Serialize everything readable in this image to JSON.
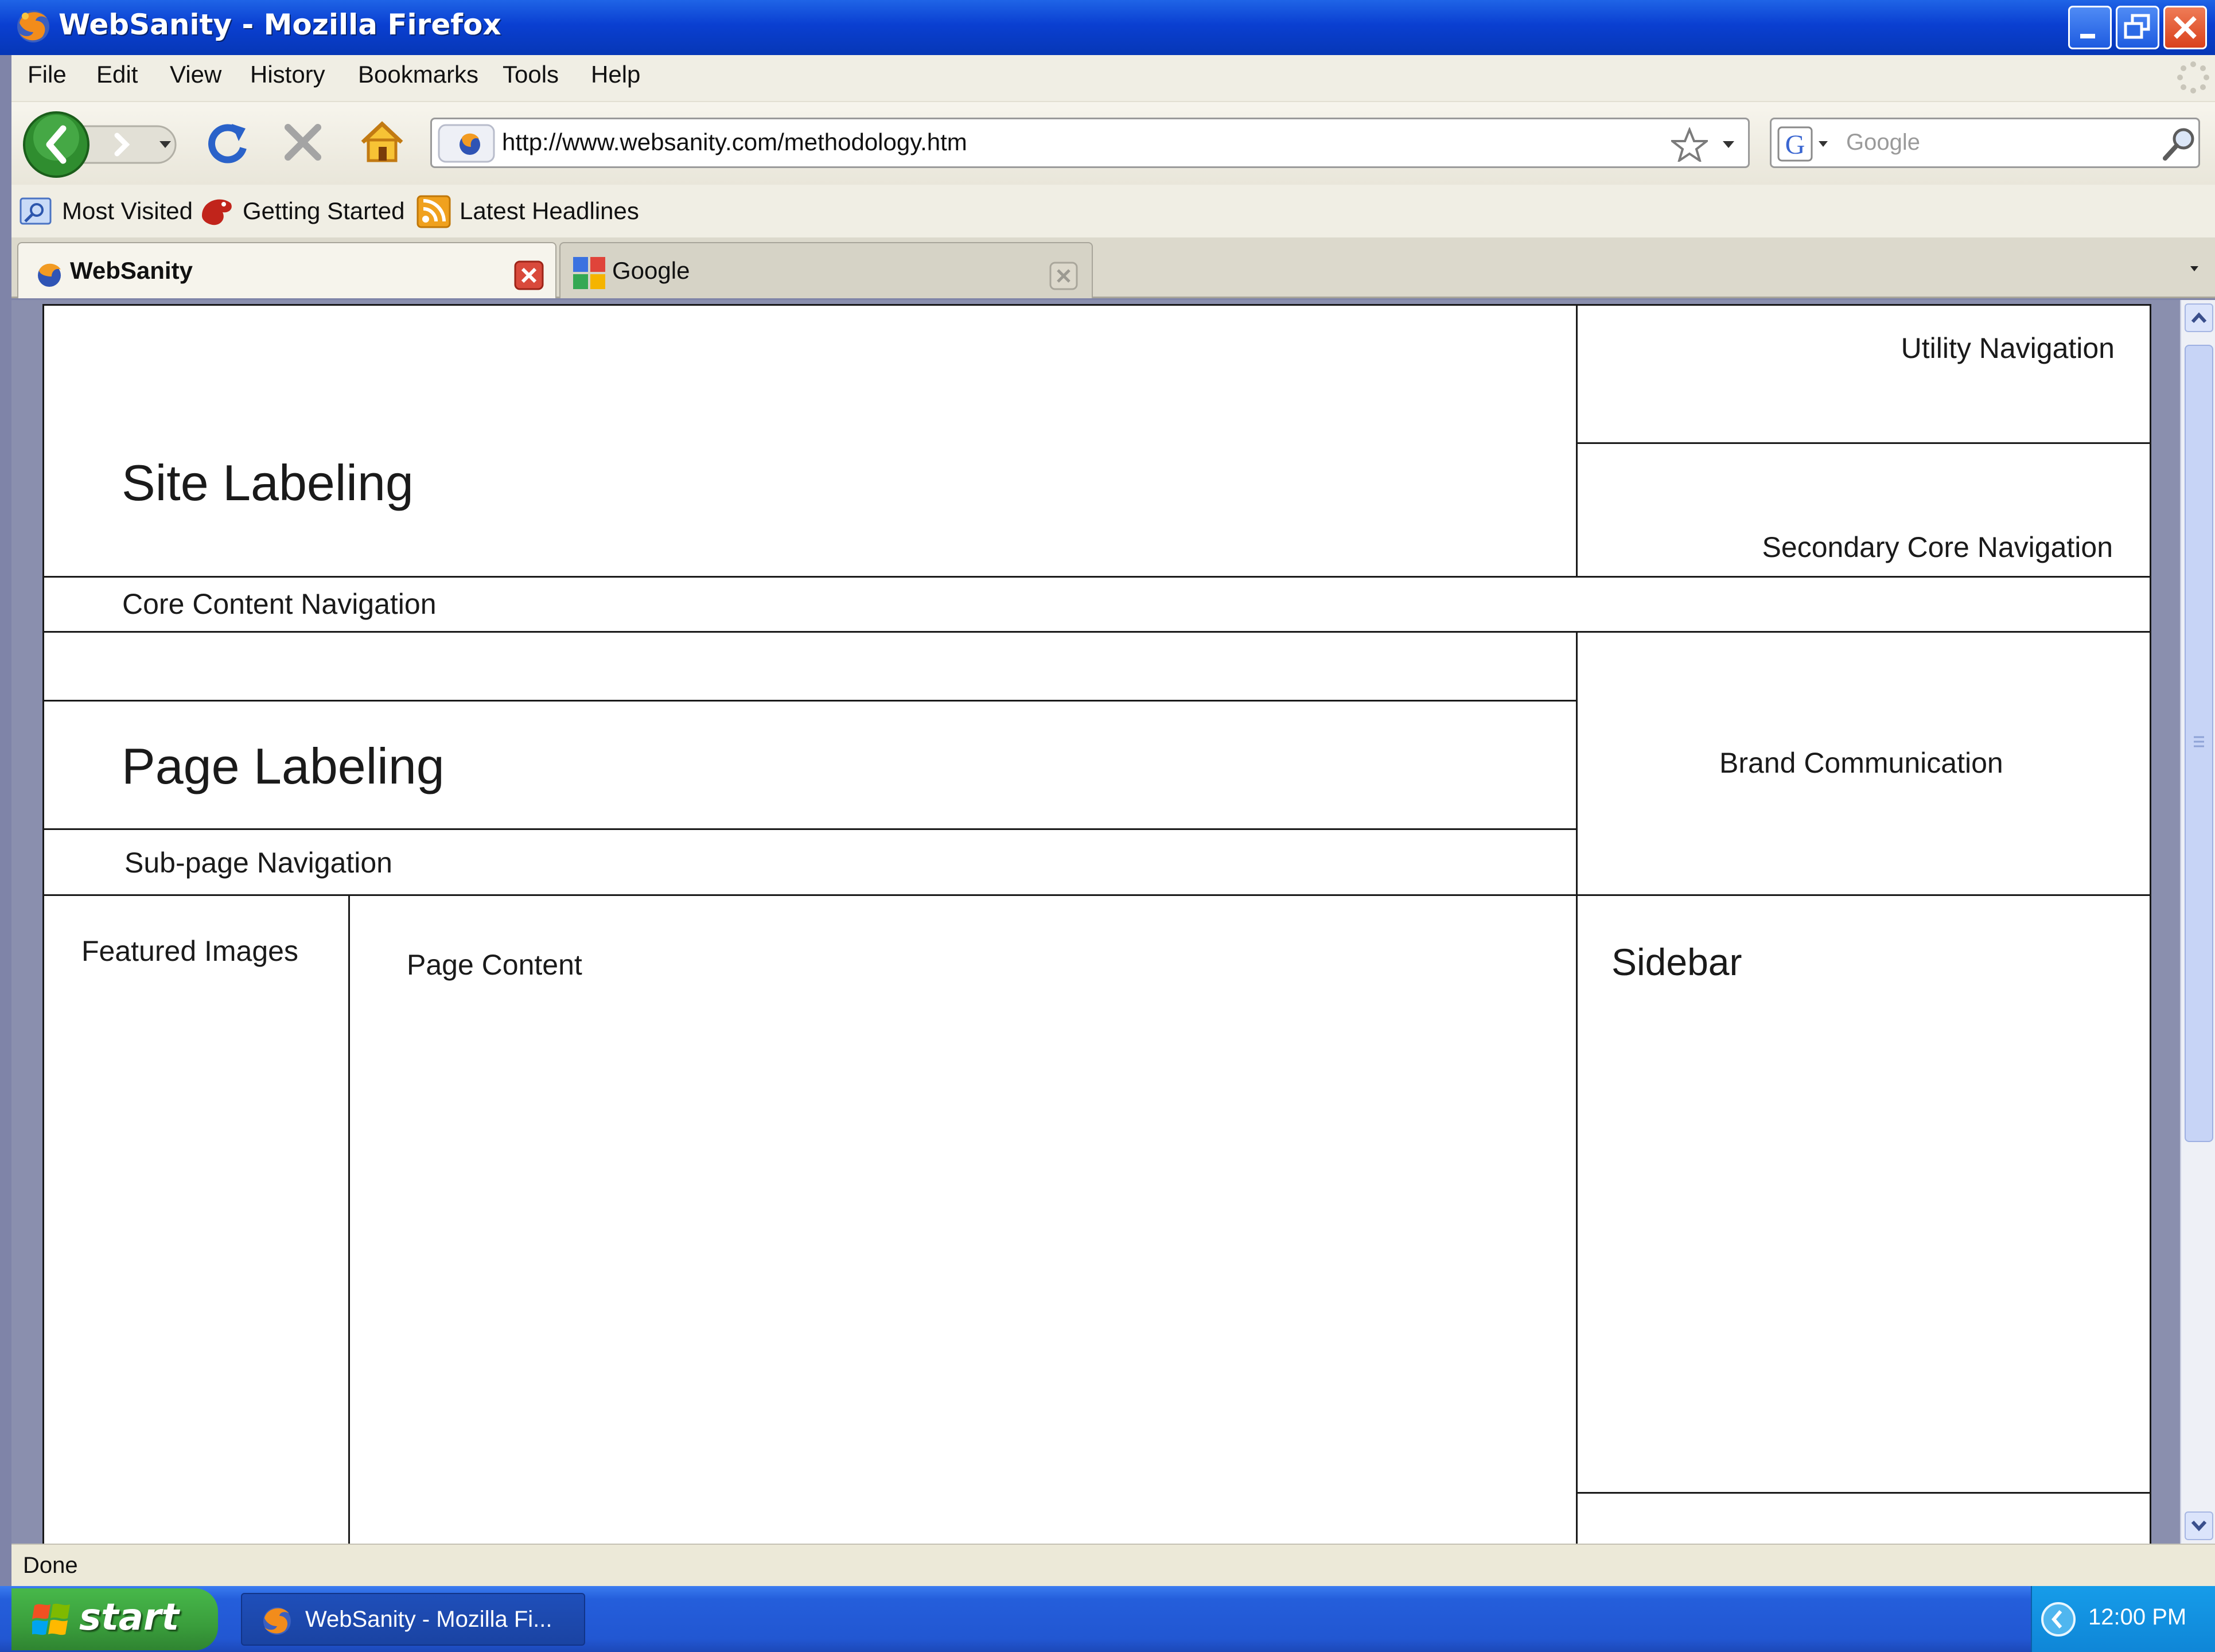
{
  "window": {
    "title": "WebSanity - Mozilla Firefox"
  },
  "menu": {
    "items": [
      {
        "label": "File"
      },
      {
        "label": "Edit"
      },
      {
        "label": "View"
      },
      {
        "label": "History"
      },
      {
        "label": "Bookmarks"
      },
      {
        "label": "Tools"
      },
      {
        "label": "Help"
      }
    ]
  },
  "navbar": {
    "url": "http://www.websanity.com/methodology.htm",
    "search_placeholder": "Google"
  },
  "bookmarks": {
    "items": [
      {
        "label": "Most Visited"
      },
      {
        "label": "Getting Started"
      },
      {
        "label": "Latest Headlines"
      }
    ]
  },
  "tabs": [
    {
      "label": "WebSanity",
      "active": true
    },
    {
      "label": "Google",
      "active": false
    }
  ],
  "wireframe": {
    "site_labeling": "Site Labeling",
    "utility_navigation": "Utility Navigation",
    "secondary_core_navigation": "Secondary Core Navigation",
    "core_content_navigation": "Core Content Navigation",
    "page_labeling": "Page Labeling",
    "brand_communication": "Brand Communication",
    "sub_page_navigation": "Sub-page Navigation",
    "featured_images": "Featured Images",
    "page_content": "Page Content",
    "sidebar": "Sidebar"
  },
  "statusbar": {
    "text": "Done"
  },
  "taskbar": {
    "start_label": "start",
    "task_label": "WebSanity - Mozilla Fi...",
    "clock": "12:00 PM"
  },
  "colors": {
    "titlebar": "#0a3fd1",
    "taskbar": "#245edb",
    "start_button": "#3a9e3c",
    "wireframe_border": "#1a1a1a"
  }
}
